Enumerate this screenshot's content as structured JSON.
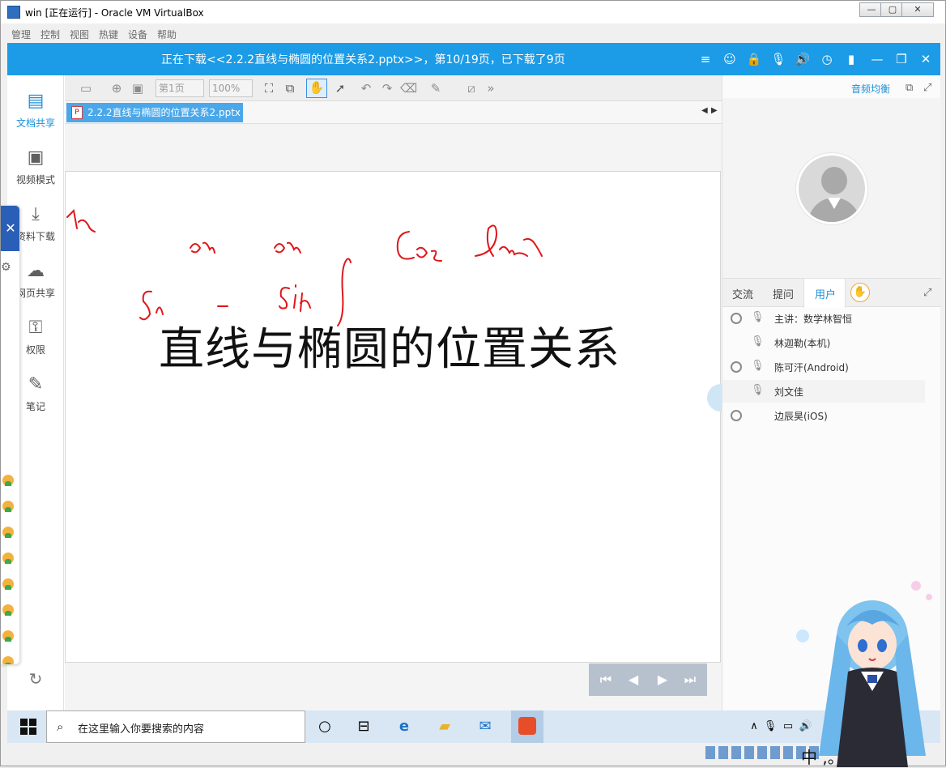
{
  "window": {
    "title": "win [正在运行] - Oracle VM VirtualBox",
    "menu": [
      "管理",
      "控制",
      "视图",
      "热键",
      "设备",
      "帮助"
    ]
  },
  "app_header": {
    "status_text": "正在下载<<2.2.2直线与椭圆的位置关系2.pptx>>，第10/19页，已下载了9页"
  },
  "leftnav": {
    "items": [
      {
        "label": "文档共享",
        "icon": "document-share-icon",
        "active": true
      },
      {
        "label": "视频模式",
        "icon": "video-mode-icon",
        "active": false
      },
      {
        "label": "资料下载",
        "icon": "download-icon",
        "active": false
      },
      {
        "label": "网页共享",
        "icon": "web-share-icon",
        "active": false
      },
      {
        "label": "权限",
        "icon": "permission-icon",
        "active": false
      },
      {
        "label": "笔记",
        "icon": "note-icon",
        "active": false
      }
    ]
  },
  "toolbar": {
    "page_select": "第1页",
    "zoom_select": "100%"
  },
  "document": {
    "tab_label": "2.2.2直线与椭圆的位置关系2.pptx",
    "slide_title": "直线与椭圆的位置关系",
    "annotations": [
      "an",
      "an",
      "an",
      "Cos",
      "ln",
      "Sh",
      "sih"
    ]
  },
  "right_panel": {
    "audio_balance": "音频均衡",
    "tabs": [
      "交流",
      "提问",
      "用户"
    ],
    "active_tab": "用户",
    "users": [
      {
        "name": "主讲：数学林智恒",
        "camera": true
      },
      {
        "name": "林迦勒(本机)",
        "camera": false
      },
      {
        "name": "陈可汗(Android)",
        "camera": true
      },
      {
        "name": "刘文佳",
        "camera": false
      },
      {
        "name": "边辰昊(iOS)",
        "camera": true
      }
    ]
  },
  "taskbar": {
    "search_placeholder": "在这里输入你要搜索的内容",
    "ime_text": "中 ,。半 简"
  },
  "colors": {
    "accent": "#1c9be6",
    "ink": "#e0161a",
    "nav_active": "#1c8fd8"
  }
}
